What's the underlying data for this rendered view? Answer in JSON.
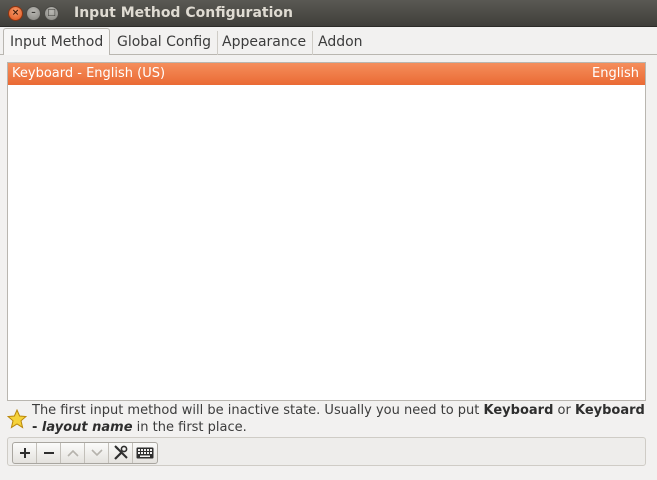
{
  "window": {
    "title": "Input Method Configuration"
  },
  "tabs": [
    {
      "label": "Input Method"
    },
    {
      "label": "Global Config"
    },
    {
      "label": "Appearance"
    },
    {
      "label": "Addon"
    }
  ],
  "input_methods": [
    {
      "name": "Keyboard - English (US)",
      "language": "English",
      "selected": true
    }
  ],
  "info": {
    "part1": "The first input method will be inactive state. Usually you need to put ",
    "bold1": "Keyboard",
    "part2": " or ",
    "bold2": "Keyboard",
    "bold3": " - ",
    "bolditalic": "layout name",
    "part3": " in the first place."
  },
  "icons": {
    "info": "star-icon",
    "add": "plus-icon",
    "remove": "minus-icon",
    "up": "arrow-up-icon",
    "down": "arrow-down-icon",
    "configure": "tools-icon",
    "keyboard": "keyboard-icon"
  },
  "colors": {
    "selection": "#ea6a34",
    "titlebar": "#3f3e3a"
  }
}
